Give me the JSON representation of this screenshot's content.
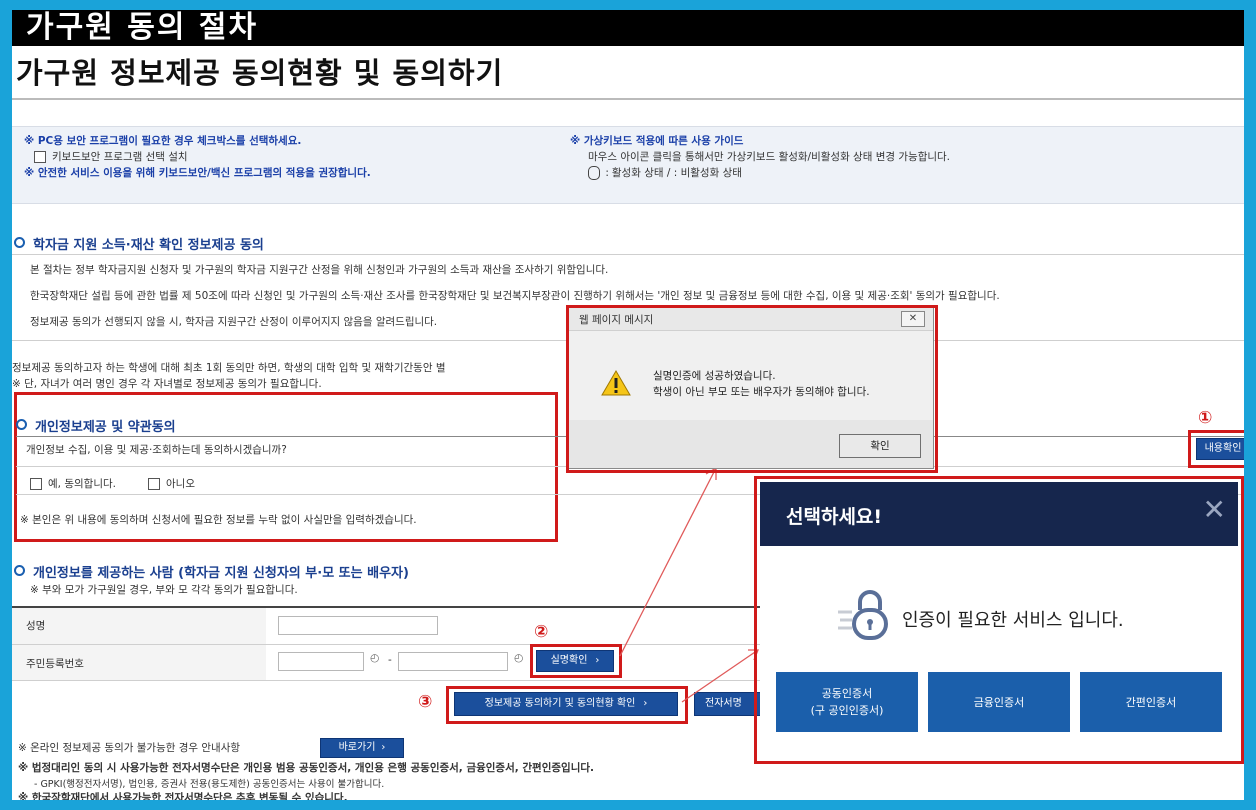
{
  "header": {
    "top_title": "가구원 동의 절차",
    "main_title": "가구원 정보제공 동의현황 및 동의하기"
  },
  "guide": {
    "pc_security_notice": "※ PC용 보안 프로그램이 필요한 경우 체크박스를 선택하세요.",
    "keyboard_install_label": "키보드보안 프로그램 선택 설치",
    "safe_use_notice": "※ 안전한 서비스 이용을 위해 키보드보안/백신 프로그램의 적용을 권장합니다.",
    "virtual_kb_title": "※ 가상키보드 적용에 따른 사용 가이드",
    "virtual_kb_desc": "마우스 아이콘 클릭을 통해서만 가상키보드 활성화/비활성화 상태 변경 가능합니다.",
    "virtual_kb_state": "활성화 상태 /   : 비활성화 상태"
  },
  "income_section": {
    "title": "학자금 지원 소득·재산 확인 정보제공 동의",
    "para1": "본 절차는 정부 학자금지원 신청자 및 가구원의 학자금 지원구간 산정을 위해 신청인과 가구원의 소득과 재산을 조사하기 위함입니다.",
    "para2": "한국장학재단 설립 등에 관한 법률 제 50조에 따라 신청인 및 가구원의 소득·재산 조사를 한국장학재단 및 보건복지부장관이 진행하기 위해서는 '개인 정보 및 금융정보 등에 대한 수집, 이용 및 제공·조회' 동의가 필요합니다.",
    "para3": "정보제공 동의가 선행되지 않을 시, 학자금 지원구간 산정이 이루어지지 않음을 알려드립니다.",
    "para4": "정보제공 동의하고자 하는 학생에 대해 최초 1회 동의만 하면, 학생의 대학 입학 및 재학기간동안 별",
    "red_note": "※ 단, 자녀가 여러 명인 경우 각 자녀별로 정보제공 동의가 필요합니다."
  },
  "consent_section": {
    "title": "개인정보제공 및 약관동의",
    "question": "개인정보 수집, 이용 및 제공·조회하는데 동의하시겠습니까?",
    "yes_label": "예, 동의합니다.",
    "no_label": "아니오",
    "pledge": "※ 본인은 위 내용에 동의하며 신청서에 필요한 정보를 누락 없이 사실만을 입력하겠습니다.",
    "detail_button": "내용확인"
  },
  "provider_section": {
    "title": "개인정보를 제공하는 사람 (학자금 지원 신청자의 부·모 또는 배우자)",
    "red_note": "※ 부와 모가 가구원일 경우, 부와 모 각각 동의가 필요합니다.",
    "name_label": "성명",
    "rrn_label": "주민등록번호",
    "rrn_separator": "-",
    "verify_button": "실명확인",
    "consent_status_button": "정보제공 동의하기 및 동의현황 확인",
    "esign_button": "전자서명"
  },
  "bottom_notes": {
    "offline_notice": "※ 온라인 정보제공 동의가 불가능한 경우 안내사항",
    "shortcut_button": "바로가기",
    "agent_notice": "※ 법정대리인 동의 시 사용가능한 전자서명수단은 개인용 범용 공동인증서, 개인용 은행 공동인증서, 금융인증서, 간편인증입니다.",
    "gpki_notice": "- GPKI(행정전자서명), 법인용, 증권사 전용(용도제한) 공동인증서는 사용이 불가합니다.",
    "last_notice": "※ 한국장학재단에서 사용가능한 전자서명수단은 추후 변동될 수 있습니다."
  },
  "markers": {
    "one": "①",
    "two": "②",
    "three": "③"
  },
  "dialog": {
    "title": "웹 페이지 메시지",
    "message_line1": "실명인증에 성공하였습니다.",
    "message_line2": "학생이 아닌 부모 또는 배우자가 동의해야 합니다.",
    "ok_button": "확인"
  },
  "modal": {
    "title": "선택하세요!",
    "message": "인증이 필요한 서비스 입니다.",
    "cert_joint_line1": "공동인증서",
    "cert_joint_line2": "(구 공인인증서)",
    "cert_finance": "금융인증서",
    "cert_simple": "간편인증서"
  },
  "colors": {
    "frame_bg": "#1aa3d9",
    "accent_red": "#d01a1a",
    "button_navy": "#1b4f9c",
    "modal_header": "#16264d"
  }
}
